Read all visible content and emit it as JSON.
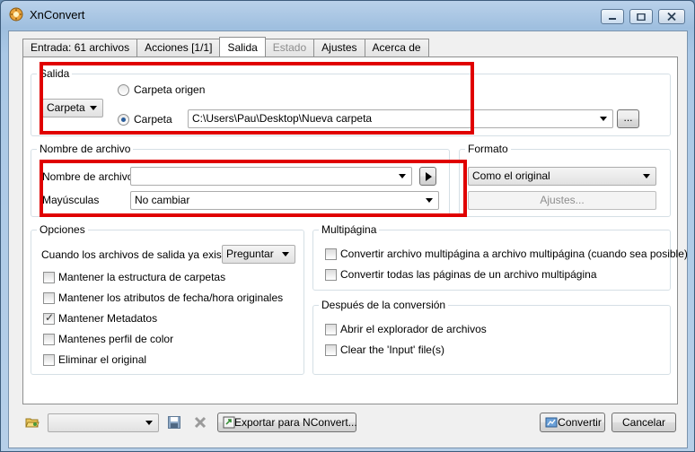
{
  "window": {
    "title": "XnConvert"
  },
  "tabs": [
    "Entrada: 61 archivos",
    "Acciones [1/1]",
    "Salida",
    "Estado",
    "Ajustes",
    "Acerca de"
  ],
  "salida": {
    "title": "Salida",
    "type_combo": "Carpeta",
    "radio_origin": "Carpeta origen",
    "radio_folder": "Carpeta",
    "path": "C:\\Users\\Pau\\Desktop\\Nueva carpeta",
    "browse_label": "..."
  },
  "nombre": {
    "title": "Nombre de archivo",
    "filename_label": "Nombre de archivo",
    "filename_value": "",
    "case_label": "Mayúsculas",
    "case_value": "No cambiar"
  },
  "formato": {
    "title": "Formato",
    "value": "Como el original",
    "settings_label": "Ajustes..."
  },
  "opciones": {
    "title": "Opciones",
    "exists_label": "Cuando los archivos de salida ya existan",
    "exists_value": "Preguntar",
    "checks": [
      {
        "label": "Mantener la estructura de carpetas",
        "checked": false
      },
      {
        "label": "Mantener los atributos de  fecha/hora originales",
        "checked": false
      },
      {
        "label": "Mantener Metadatos",
        "checked": true
      },
      {
        "label": "Mantenes perfil de color",
        "checked": false
      },
      {
        "label": "Eliminar el original",
        "checked": false
      }
    ]
  },
  "multipagina": {
    "title": "Multipágina",
    "checks": [
      {
        "label": "Convertir archivo multipágina a archivo multipágina (cuando sea posible)",
        "checked": false
      },
      {
        "label": "Convertir todas las páginas de un archivo multipágina",
        "checked": false
      }
    ]
  },
  "despues": {
    "title": "Después de la conversión",
    "checks": [
      {
        "label": "Abrir el explorador de archivos",
        "checked": false
      },
      {
        "label": "Clear the 'Input' file(s)",
        "checked": false
      }
    ]
  },
  "footer": {
    "preset_value": "",
    "export_label": "Exportar para NConvert...",
    "convert_label": "Convertir",
    "cancel_label": "Cancelar"
  },
  "colors": {
    "highlight": "#e00000",
    "accent": "#2a5e9c"
  }
}
